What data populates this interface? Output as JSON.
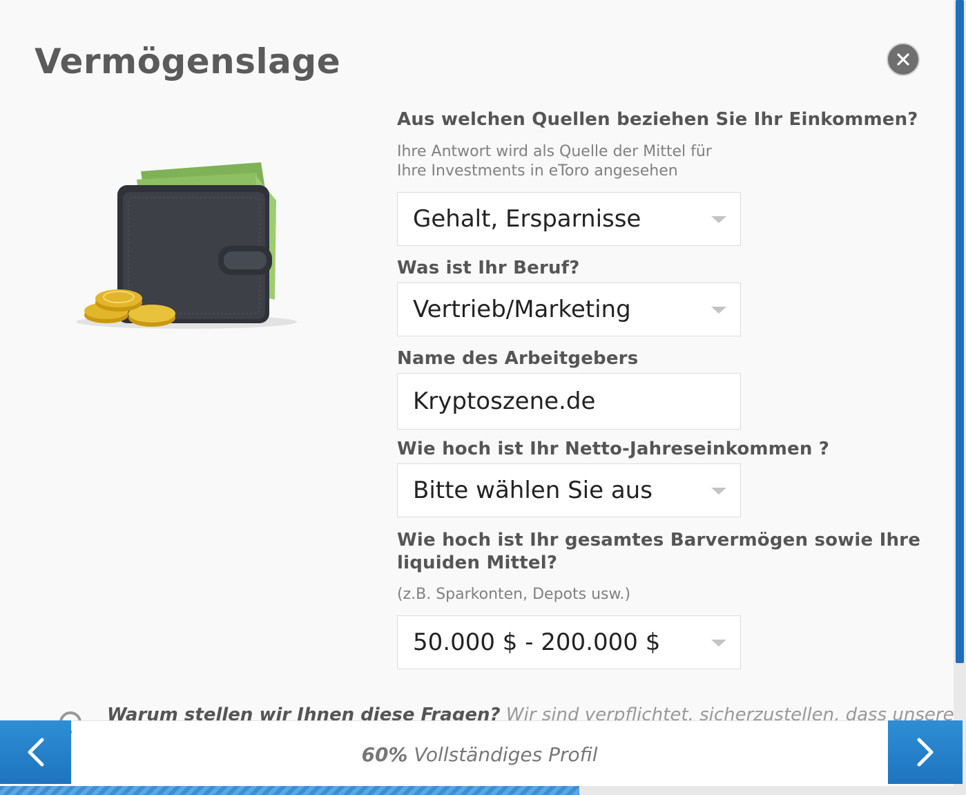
{
  "modal": {
    "title": "Vermögenslage",
    "close_icon": "close-icon"
  },
  "questions": {
    "income_source": {
      "label": "Aus welchen Quellen beziehen Sie Ihr Einkommen?",
      "hint_line1": "Ihre Antwort wird als Quelle der Mittel für",
      "hint_line2": "Ihre Investments in eToro angesehen",
      "value": "Gehalt, Ersparnisse"
    },
    "profession": {
      "label": "Was ist Ihr Beruf?",
      "value": "Vertrieb/Marketing"
    },
    "employer": {
      "label": "Name des Arbeitgebers",
      "value": "Kryptoszene.de"
    },
    "net_income": {
      "label": "Wie hoch ist Ihr Netto-Jahreseinkommen ?",
      "value": "Bitte wählen Sie aus"
    },
    "liquid_assets": {
      "label_line1": "Wie hoch ist Ihr gesamtes Barvermögen sowie Ihre",
      "label_line2": "liquiden Mittel?",
      "hint": "(z.B. Sparkonten, Depots usw.)",
      "value": "50.000 $ - 200.000 $"
    }
  },
  "why": {
    "bold": "Warum stellen wir Ihnen diese Fragen?",
    "rest": " Wir sind verpflichtet, sicherzustellen, dass unsere"
  },
  "footer": {
    "progress_percent": "60%",
    "progress_label": " Vollständiges Profil",
    "progress_fraction": 0.6,
    "prev_icon": "chevron-left-icon",
    "next_icon": "chevron-right-icon"
  },
  "colors": {
    "accent": "#2e8ed4",
    "title": "#5b5b5b",
    "wallet": "#3d4047",
    "cash": "#8cc063",
    "coin": "#e2b62a"
  }
}
